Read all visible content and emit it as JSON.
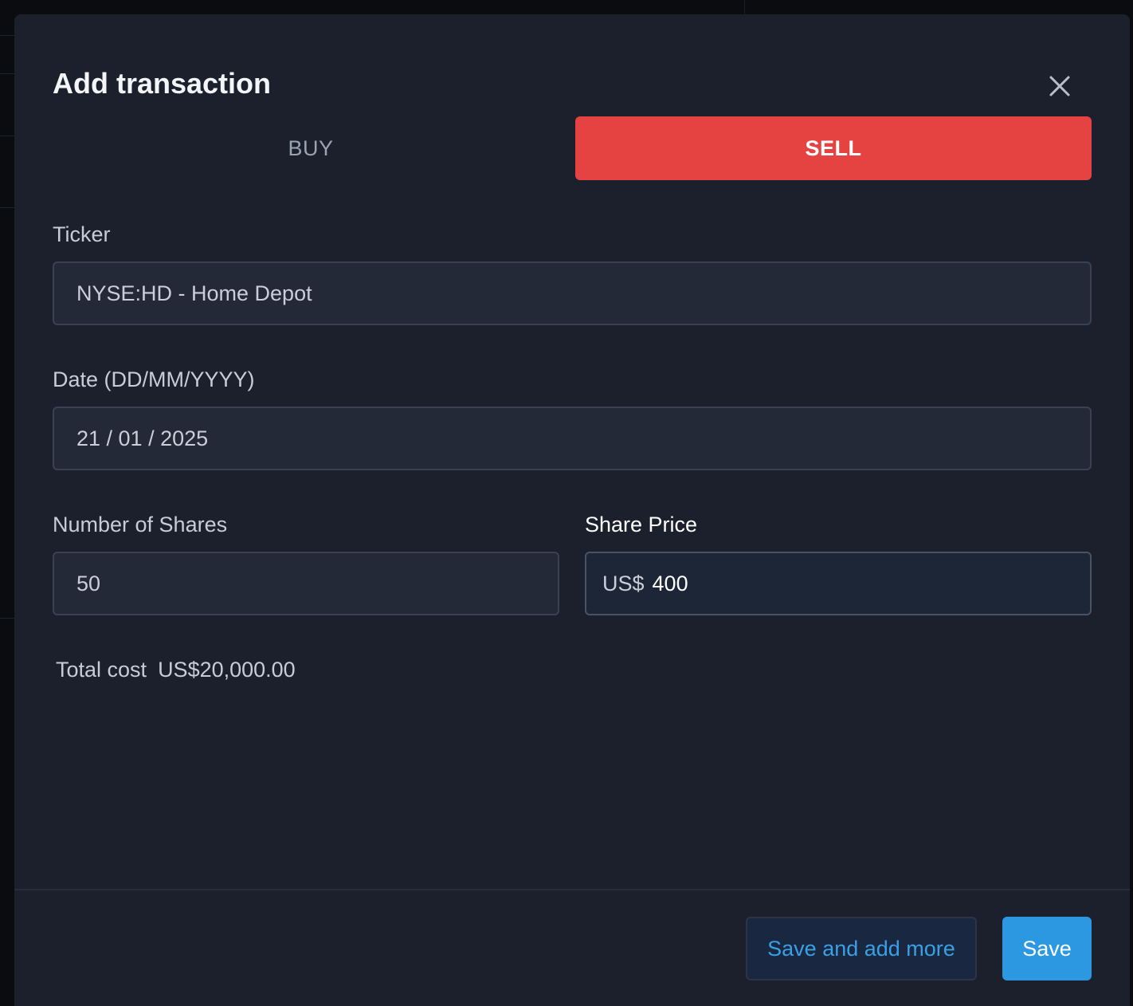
{
  "modal": {
    "title": "Add transaction",
    "close_icon": "close-icon"
  },
  "type_toggle": {
    "buy_label": "BUY",
    "sell_label": "SELL",
    "selected": "SELL"
  },
  "ticker": {
    "label": "Ticker",
    "value": "NYSE:HD - Home Depot"
  },
  "date": {
    "label": "Date (DD/MM/YYYY)",
    "value": "21 / 01 / 2025"
  },
  "shares": {
    "label": "Number of Shares",
    "value": "50"
  },
  "price": {
    "label": "Share Price",
    "prefix": "US$",
    "value": "400"
  },
  "total": {
    "label": "Total cost",
    "value": "US$20,000.00"
  },
  "footer": {
    "save_more_label": "Save and add more",
    "save_label": "Save"
  },
  "colors": {
    "sell_accent": "#e54242",
    "primary_button": "#2c98e2",
    "modal_background": "#1c202d"
  }
}
